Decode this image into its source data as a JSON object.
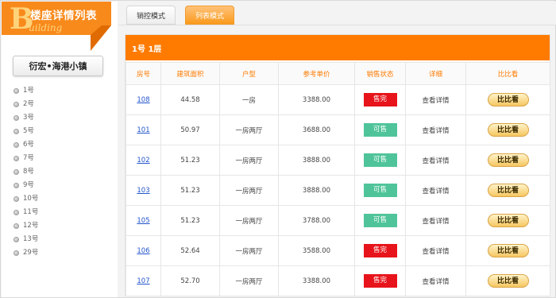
{
  "logo": {
    "letter": "B",
    "title": "楼座详情列表",
    "subtitle": "uilding"
  },
  "project_name": "衍宏•海港小镇",
  "buildings": [
    "1号",
    "2号",
    "3号",
    "5号",
    "6号",
    "7号",
    "8号",
    "9号",
    "10号",
    "11号",
    "12号",
    "13号",
    "29号"
  ],
  "tabs": {
    "control": "销控模式",
    "list": "列表模式"
  },
  "floor_title": "1号  1层",
  "table": {
    "headers": [
      "房号",
      "建筑面积",
      "户型",
      "参考单价",
      "销售状态",
      "详细",
      "比比看"
    ],
    "rows": [
      {
        "unit": "108",
        "area": "44.58",
        "layout": "一房",
        "price": "3388.00",
        "status": "售完",
        "status_type": "sold",
        "detail": "查看详情",
        "compare": "比比看"
      },
      {
        "unit": "101",
        "area": "50.97",
        "layout": "一房两厅",
        "price": "3688.00",
        "status": "可售",
        "status_type": "available",
        "detail": "查看详情",
        "compare": "比比看"
      },
      {
        "unit": "102",
        "area": "51.23",
        "layout": "一房两厅",
        "price": "3888.00",
        "status": "可售",
        "status_type": "available",
        "detail": "查看详情",
        "compare": "比比看"
      },
      {
        "unit": "103",
        "area": "51.23",
        "layout": "一房两厅",
        "price": "3888.00",
        "status": "可售",
        "status_type": "available",
        "detail": "查看详情",
        "compare": "比比看"
      },
      {
        "unit": "105",
        "area": "51.23",
        "layout": "一房两厅",
        "price": "3788.00",
        "status": "可售",
        "status_type": "available",
        "detail": "查看详情",
        "compare": "比比看"
      },
      {
        "unit": "106",
        "area": "52.64",
        "layout": "一房两厅",
        "price": "3588.00",
        "status": "售完",
        "status_type": "sold",
        "detail": "查看详情",
        "compare": "比比看"
      },
      {
        "unit": "107",
        "area": "52.70",
        "layout": "一房两厅",
        "price": "3388.00",
        "status": "售完",
        "status_type": "sold",
        "detail": "查看详情",
        "compare": "比比看"
      }
    ]
  },
  "colors": {
    "accent": "#ff7b00",
    "sold": "#e8141b",
    "available": "#4fc49a",
    "link": "#2255cc"
  }
}
